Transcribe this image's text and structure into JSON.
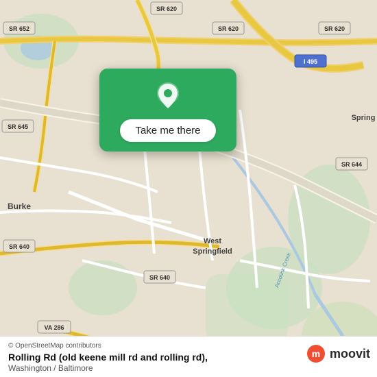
{
  "map": {
    "attribution": "© OpenStreetMap contributors",
    "road_labels": [
      "SR 652",
      "SR 620",
      "SR 645",
      "I 495",
      "SR 644",
      "SR 640",
      "SR 640",
      "VA 286",
      "VA 286"
    ],
    "place_labels": [
      "Burke",
      "West Springfield",
      "Spring"
    ]
  },
  "popup": {
    "button_label": "Take me there"
  },
  "location": {
    "title": "Rolling Rd (old keene mill rd and rolling rd),",
    "subtitle": "Washington / Baltimore"
  },
  "branding": {
    "name": "moovit"
  }
}
